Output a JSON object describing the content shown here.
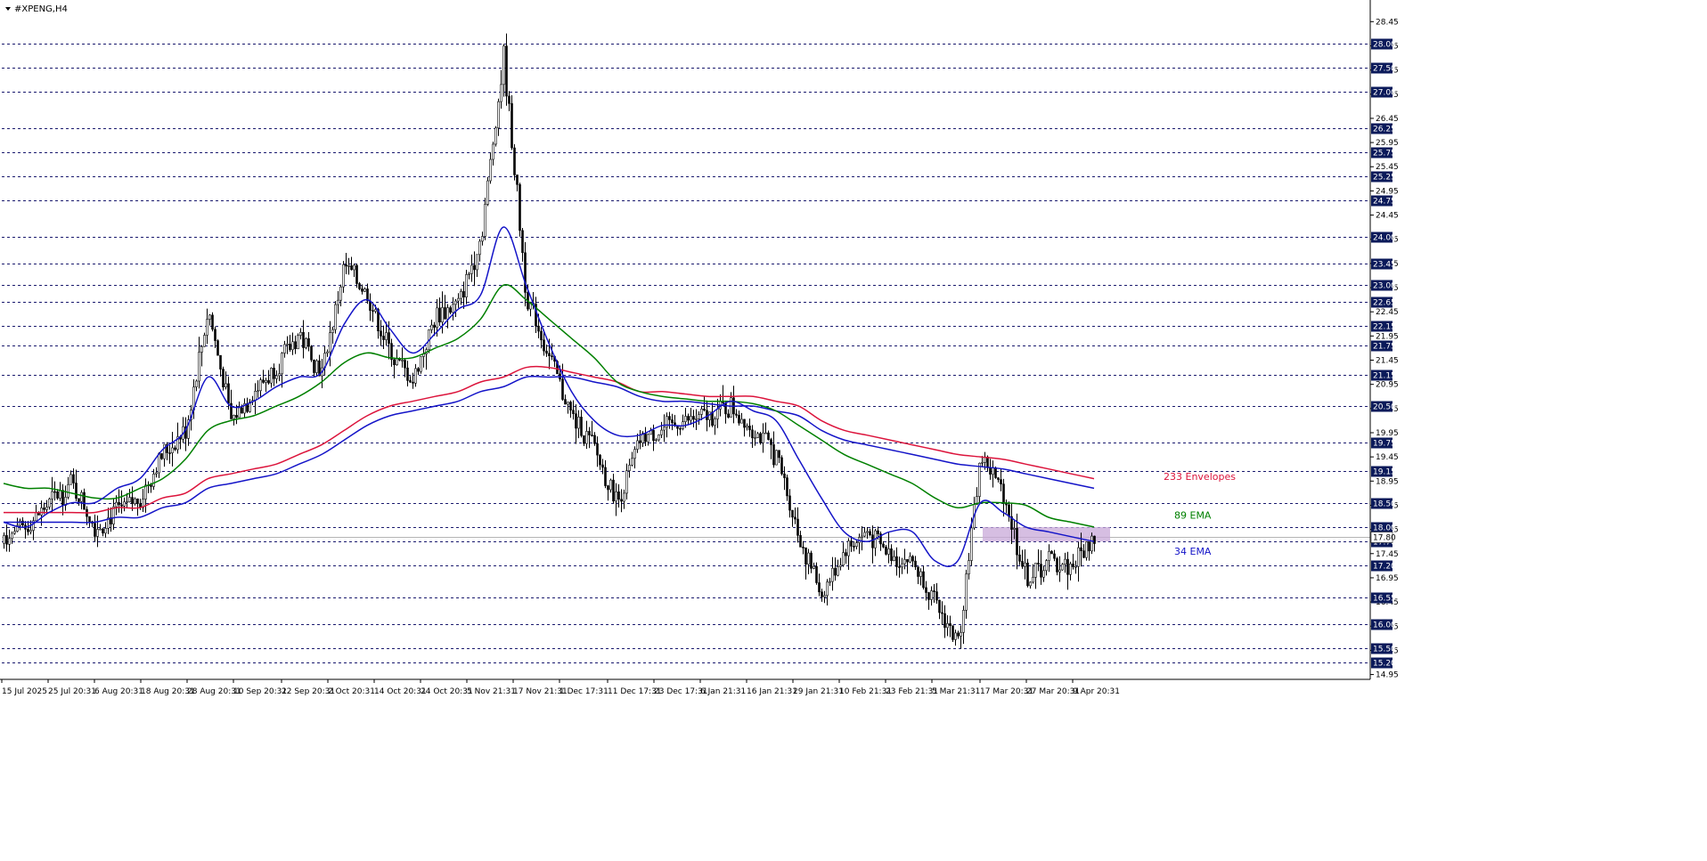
{
  "header": {
    "symbol_title": "#XPENG,H4"
  },
  "colors": {
    "background": "#ffffff",
    "candle": "#000000",
    "level_line": "#1a1a6e",
    "level_label_bg": "#0b1a5a",
    "level_label_text": "#ffffff",
    "ema34": "#1414c8",
    "ema89": "#008000",
    "env233_upper": "#dc143c",
    "env233_lower": "#1414c8",
    "zone_fill": "#c8a8d8",
    "current_price_line": "#b4b4b4"
  },
  "chart_data": {
    "type": "candlestick",
    "title": "#XPENG,H4",
    "ylim": [
      14.85,
      28.75
    ],
    "y_ticks": [
      14.95,
      15.45,
      15.95,
      16.45,
      16.95,
      17.45,
      17.95,
      18.45,
      18.95,
      19.45,
      19.95,
      20.45,
      20.95,
      21.45,
      21.95,
      22.45,
      22.95,
      23.45,
      23.95,
      24.45,
      24.95,
      25.45,
      25.95,
      26.45,
      26.95,
      27.45,
      27.95,
      28.45
    ],
    "y_tick_labels": [
      "14.95",
      "15.45",
      "15.95",
      "16.45",
      "16.95",
      "17.45",
      "17.95",
      "18.45",
      "18.95",
      "19.45",
      "19.95",
      "20.45",
      "20.95",
      "21.45",
      "21.95",
      "22.45",
      "22.95",
      "23.45",
      "23.95",
      "24.45",
      "24.95",
      "25.45",
      "25.95",
      "26.45",
      "26.95",
      "27.45",
      "27.95",
      "28.45"
    ],
    "horizontal_levels": [
      28.0,
      27.5,
      27.0,
      26.25,
      25.75,
      25.25,
      24.75,
      24.0,
      23.45,
      23.0,
      22.65,
      22.15,
      21.75,
      21.15,
      20.5,
      19.75,
      19.15,
      18.5,
      18.0,
      17.7,
      17.2,
      16.55,
      16.0,
      15.5,
      15.2
    ],
    "horizontal_level_labels": [
      "28.00",
      "27.50",
      "27.00",
      "26.25",
      "25.75",
      "25.25",
      "24.75",
      "24.00",
      "23.45",
      "23.00",
      "22.65",
      "22.15",
      "21.75",
      "21.15",
      "20.50",
      "19.75",
      "19.15",
      "18.50",
      "18.00",
      "17.70",
      "17.20",
      "16.55",
      "16.00",
      "15.50",
      "15.20"
    ],
    "current_price": 17.8,
    "current_price_label": "17.80",
    "x_labels": [
      "15 Jul 2025",
      "25 Jul 20:31",
      "6 Aug 20:31",
      "18 Aug 20:31",
      "28 Aug 20:31",
      "10 Sep 20:31",
      "22 Sep 20:31",
      "2 Oct 20:31",
      "14 Oct 20:31",
      "24 Oct 20:31",
      "5 Nov 21:31",
      "17 Nov 21:31",
      "1 Dec 17:31",
      "11 Dec 17:31",
      "23 Dec 17:31",
      "6 Jan 21:31",
      "16 Jan 21:31",
      "29 Jan 21:31",
      "10 Feb 21:31",
      "23 Feb 21:31",
      "5 Mar 21:31",
      "17 Mar 20:31",
      "27 Mar 20:31",
      "9 Apr 20:31"
    ],
    "series": [
      {
        "name": "233 Envelopes",
        "color": "#dc143c",
        "values": [
          18.3,
          18.3,
          18.3,
          18.3,
          18.3,
          18.4,
          18.4,
          18.6,
          18.7,
          19.0,
          19.1,
          19.2,
          19.3,
          19.5,
          19.7,
          20.0,
          20.3,
          20.5,
          20.6,
          20.7,
          20.8,
          21.0,
          21.1,
          21.3,
          21.3,
          21.2,
          21.1,
          21.0,
          20.8,
          20.8,
          20.75,
          20.7,
          20.7,
          20.7,
          20.6,
          20.5,
          20.2,
          20.0,
          19.9,
          19.8,
          19.7,
          19.6,
          19.5,
          19.45,
          19.4,
          19.3,
          19.2,
          19.1,
          19.0
        ]
      },
      {
        "name": "233 Envelopes",
        "color": "#1414c8",
        "values": [
          18.1,
          18.1,
          18.1,
          18.1,
          18.1,
          18.2,
          18.2,
          18.4,
          18.5,
          18.8,
          18.9,
          19.0,
          19.1,
          19.3,
          19.5,
          19.8,
          20.1,
          20.3,
          20.4,
          20.5,
          20.6,
          20.8,
          20.9,
          21.1,
          21.1,
          21.1,
          21.0,
          20.9,
          20.7,
          20.6,
          20.6,
          20.55,
          20.5,
          20.5,
          20.4,
          20.3,
          20.0,
          19.8,
          19.7,
          19.6,
          19.5,
          19.4,
          19.3,
          19.25,
          19.2,
          19.1,
          19.0,
          18.9,
          18.8
        ]
      },
      {
        "name": "89 EMA",
        "color": "#008000",
        "values": [
          18.9,
          18.8,
          18.8,
          18.7,
          18.6,
          18.6,
          18.8,
          19.0,
          19.4,
          20.0,
          20.2,
          20.3,
          20.5,
          20.7,
          21.0,
          21.4,
          21.6,
          21.5,
          21.5,
          21.7,
          21.9,
          22.3,
          23.0,
          22.7,
          22.3,
          21.9,
          21.5,
          21.0,
          20.8,
          20.7,
          20.65,
          20.6,
          20.6,
          20.55,
          20.4,
          20.1,
          19.8,
          19.5,
          19.3,
          19.1,
          18.9,
          18.6,
          18.4,
          18.5,
          18.5,
          18.45,
          18.2,
          18.1,
          18.0
        ]
      },
      {
        "name": "34 EMA",
        "color": "#1414c8",
        "values": [
          18.1,
          18.0,
          18.3,
          18.5,
          18.5,
          18.8,
          19.0,
          19.6,
          20.0,
          21.1,
          20.5,
          20.6,
          20.9,
          21.1,
          21.2,
          22.2,
          22.7,
          22.1,
          21.6,
          22.0,
          22.5,
          22.8,
          24.2,
          23.0,
          21.8,
          20.8,
          20.2,
          19.9,
          19.9,
          20.1,
          20.1,
          20.3,
          20.6,
          20.4,
          20.2,
          19.4,
          18.6,
          17.9,
          17.7,
          17.9,
          17.9,
          17.3,
          17.3,
          18.5,
          18.3,
          18.0,
          17.9,
          17.8,
          17.7
        ]
      },
      {
        "name": "price",
        "color": "#000000",
        "values": [
          17.8,
          18.0,
          18.5,
          18.9,
          18.0,
          18.3,
          18.6,
          19.5,
          20.0,
          22.5,
          20.2,
          20.8,
          21.3,
          22.0,
          21.2,
          23.4,
          22.8,
          21.6,
          21.0,
          22.4,
          22.6,
          24.0,
          27.7,
          22.8,
          21.5,
          20.3,
          19.6,
          18.5,
          19.8,
          20.0,
          20.2,
          20.3,
          20.5,
          20.0,
          19.5,
          17.8,
          16.6,
          17.5,
          17.9,
          17.4,
          17.3,
          16.4,
          15.6,
          19.5,
          18.7,
          16.9,
          17.3,
          17.2,
          17.8
        ]
      }
    ]
  },
  "indicator_labels": {
    "envelopes": "233 Envelopes",
    "ema89": "89 EMA",
    "ema34": "34 EMA"
  },
  "zone": {
    "price_high": 18.0,
    "price_low": 17.7
  }
}
